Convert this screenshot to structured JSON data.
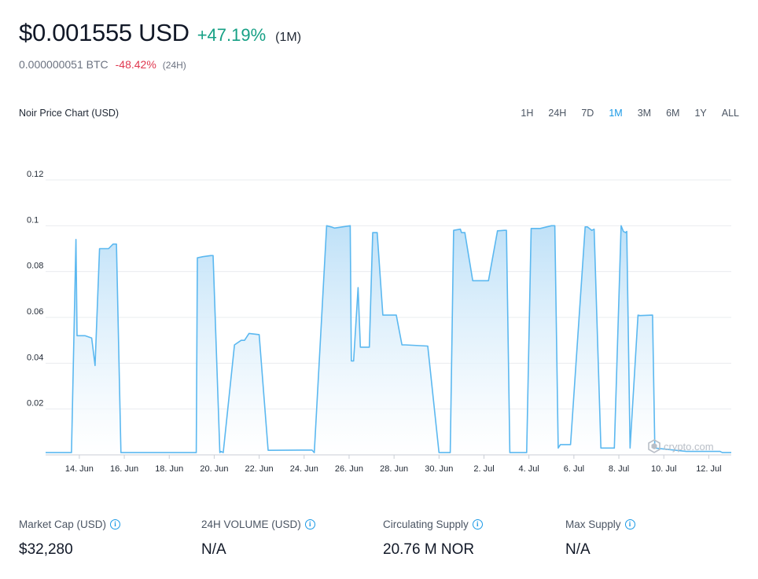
{
  "header": {
    "price": "$0.001555 USD",
    "change": "+47.19%",
    "period": "(1M)",
    "btc_price": "0.000000051 BTC",
    "btc_change": "-48.42%",
    "btc_period": "(24H)"
  },
  "chart_header": {
    "title": "Noir Price Chart (USD)",
    "ranges": [
      "1H",
      "24H",
      "7D",
      "1M",
      "3M",
      "6M",
      "1Y",
      "ALL"
    ],
    "active_range": "1M"
  },
  "watermark": "crypto.com",
  "colors": {
    "line": "#5bb8f0",
    "fill_top": "#bfe1f8",
    "fill_bottom": "#ffffff",
    "accent": "#1a99e6",
    "positive": "#16a085",
    "negative": "#e0384f"
  },
  "stats": [
    {
      "label": "Market Cap (USD)",
      "value": "$32,280"
    },
    {
      "label": "24H VOLUME (USD)",
      "value": "N/A"
    },
    {
      "label": "Circulating Supply",
      "value": "20.76 M NOR"
    },
    {
      "label": "Max Supply",
      "value": "N/A"
    }
  ],
  "chart_data": {
    "type": "area",
    "title": "Noir Price Chart (USD)",
    "xlabel": "",
    "ylabel": "",
    "ylim": [
      0,
      0.12
    ],
    "yticks": [
      0.02,
      0.04,
      0.06,
      0.08,
      0.1,
      0.12
    ],
    "ytick_labels": [
      "0.02",
      "0.04",
      "0.06",
      "0.08",
      "0.1",
      "0.12"
    ],
    "xlim": [
      12.5,
      43.0
    ],
    "xticks": [
      14,
      16,
      18,
      20,
      22,
      24,
      26,
      28,
      30,
      32,
      34,
      36,
      38,
      40,
      42
    ],
    "xtick_labels": [
      "14. Jun",
      "16. Jun",
      "18. Jun",
      "20. Jun",
      "22. Jun",
      "24. Jun",
      "26. Jun",
      "28. Jun",
      "30. Jun",
      "2. Jul",
      "4. Jul",
      "6. Jul",
      "8. Jul",
      "10. Jul",
      "12. Jul"
    ],
    "grid": true,
    "legend": "none",
    "series": [
      {
        "x": [
          12.5,
          13.65,
          13.85,
          13.9,
          14.25,
          14.55,
          14.7,
          14.9,
          15.3,
          15.5,
          15.65,
          15.85,
          16.0,
          16.15,
          18.0,
          19.2,
          19.25,
          19.5,
          19.85,
          19.95,
          20.25,
          20.3,
          20.4,
          20.9,
          21.2,
          21.35,
          21.55,
          22.0,
          22.4,
          24.35,
          24.45,
          25.0,
          25.2,
          25.35,
          26.05,
          26.1,
          26.15,
          26.2,
          26.4,
          26.5,
          26.9,
          27.05,
          27.25,
          27.5,
          28.1,
          28.35,
          28.5,
          29.5,
          30.0,
          30.35,
          30.5,
          30.65,
          30.95,
          31.0,
          31.15,
          31.5,
          32.2,
          32.6,
          32.9,
          33.0,
          33.15,
          33.55,
          33.9,
          34.1,
          34.5,
          35.0,
          35.15,
          35.3,
          35.4,
          35.55,
          35.85,
          36.5,
          36.6,
          36.8,
          36.9,
          37.2,
          37.8,
          38.1,
          38.2,
          38.3,
          38.35,
          38.5,
          38.85,
          38.95,
          39.5,
          39.6,
          41.0,
          42.5,
          42.6,
          43.0
        ],
        "y": [
          0.001,
          0.001,
          0.094,
          0.052,
          0.052,
          0.051,
          0.039,
          0.09,
          0.09,
          0.092,
          0.092,
          0.001,
          0.001,
          0.001,
          0.001,
          0.001,
          0.086,
          0.0865,
          0.087,
          0.087,
          0.001,
          0.0015,
          0.001,
          0.048,
          0.05,
          0.05,
          0.053,
          0.0525,
          0.002,
          0.0021,
          0.001,
          0.1,
          0.0995,
          0.099,
          0.1,
          0.041,
          0.041,
          0.041,
          0.073,
          0.047,
          0.047,
          0.097,
          0.097,
          0.061,
          0.061,
          0.048,
          0.048,
          0.0475,
          0.001,
          0.001,
          0.001,
          0.098,
          0.0985,
          0.097,
          0.097,
          0.076,
          0.076,
          0.0978,
          0.098,
          0.098,
          0.001,
          0.001,
          0.001,
          0.0988,
          0.0988,
          0.1,
          0.1,
          0.003,
          0.0045,
          0.0045,
          0.0045,
          0.0995,
          0.0995,
          0.098,
          0.0985,
          0.003,
          0.003,
          0.1,
          0.0975,
          0.097,
          0.0975,
          0.003,
          0.061,
          0.0608,
          0.061,
          0.003,
          0.0015,
          0.0015,
          0.001,
          0.001
        ]
      }
    ]
  }
}
